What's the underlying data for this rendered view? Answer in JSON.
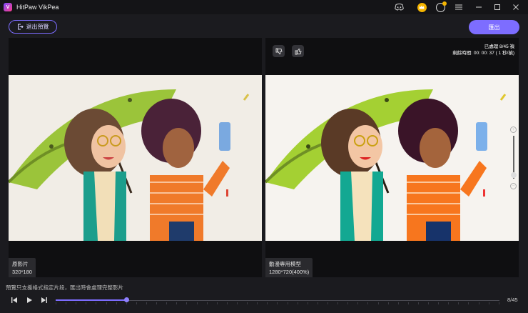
{
  "app": {
    "title": "HitPaw VikPea",
    "logo_letter": "V"
  },
  "window_controls": {
    "icons": [
      "discord-icon",
      "crown-icon",
      "account-icon",
      "menu-icon",
      "minimize-icon",
      "maximize-icon",
      "close-icon"
    ]
  },
  "toolbar": {
    "exit_label": "退出預覽",
    "export_label": "匯出"
  },
  "left_panel": {
    "label": "原影片",
    "resolution": "320*180"
  },
  "right_panel": {
    "label": "動漫專用模型",
    "resolution": "1280*720(400%)",
    "processed": "已處理 8/45 禎",
    "remaining": "剩餘時間: 00: 00: 37 ( 1 秒/禎)"
  },
  "zoom": {
    "plus": "+",
    "minus": "−"
  },
  "bottom": {
    "note": "預覽只支援格式指定片段，匯出時會處理完整影片",
    "frame_counter": "8/45",
    "progress": 0.159
  },
  "colors": {
    "accent": "#7d6dff",
    "background": "#1b1b1f"
  }
}
